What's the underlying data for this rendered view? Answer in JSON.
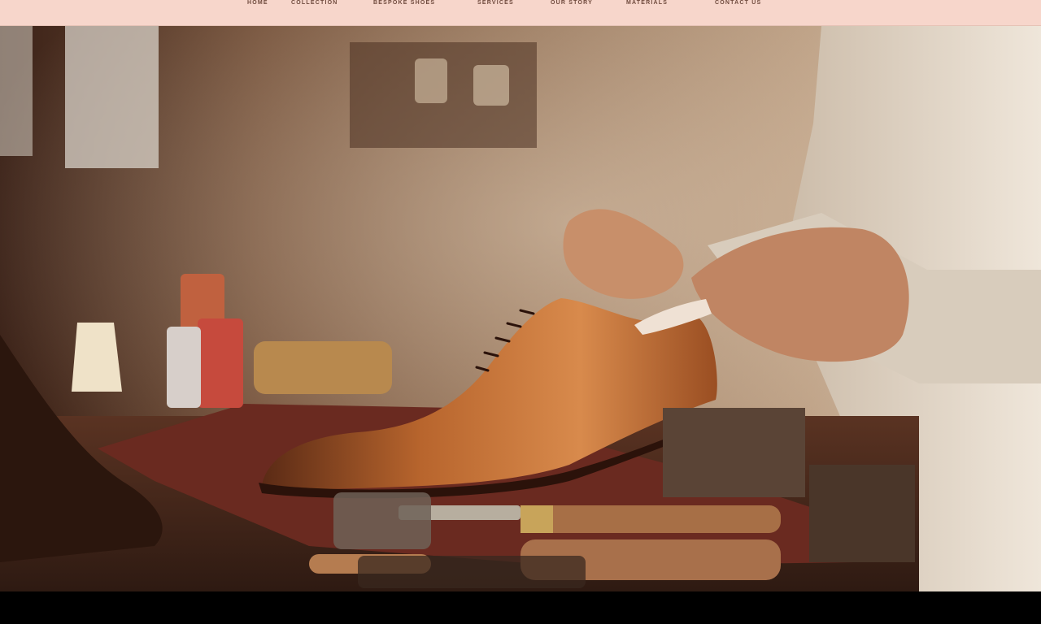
{
  "nav": {
    "items": [
      {
        "label": "Home"
      },
      {
        "label": "Collection"
      },
      {
        "label": "Bespoke Shoes"
      },
      {
        "label": "Services"
      },
      {
        "label": "Our Story"
      },
      {
        "label": "Materials"
      },
      {
        "label": "Contact Us"
      }
    ]
  },
  "hero": {
    "image": "shoemaker-workshop-photo"
  },
  "colors": {
    "nav_bg": "#f7d6cb",
    "nav_text": "#6f4a3d",
    "footer_bg": "#000000"
  }
}
